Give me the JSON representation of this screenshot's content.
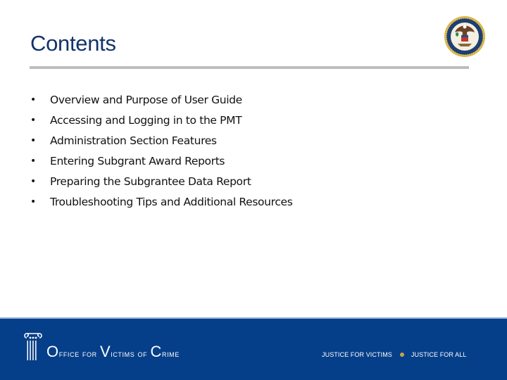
{
  "slide": {
    "title": "Contents",
    "seal_icon": "doj-seal-icon"
  },
  "contents": {
    "bullet": "•",
    "items": [
      "Overview and Purpose of User Guide",
      "Accessing and Logging in to the PMT",
      "Administration Section Features",
      "Entering Subgrant Award Reports",
      "Preparing the Subgrantee Data Report",
      "Troubleshooting Tips and Additional Resources"
    ]
  },
  "footer": {
    "logo_icon": "pillar-icon",
    "org_name": {
      "w1_initial": "O",
      "w1_rest": "ffice for ",
      "w2_initial": "V",
      "w2_rest": "ictims of ",
      "w3_initial": "C",
      "w3_rest": "rime"
    },
    "tagline_left": "JUSTICE FOR VICTIMS",
    "tagline_right": "JUSTICE FOR ALL",
    "colors": {
      "background": "#063f89",
      "dot": "#c9a14a",
      "title": "#13336b"
    }
  }
}
